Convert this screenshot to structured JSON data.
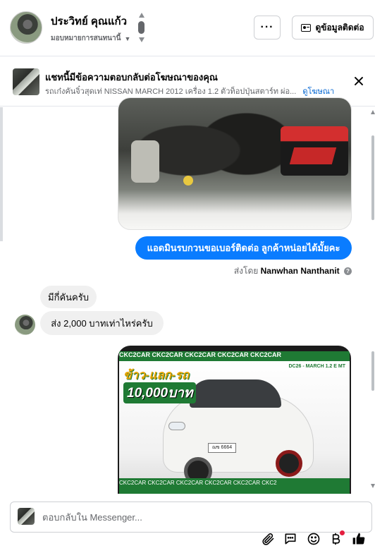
{
  "header": {
    "contact_name": "ประวิทย์ คุณแก้ว",
    "assign_label": "มอบหมายการสนทนานี้",
    "more_label": "···",
    "view_contact_label": "ดูข้อมูลติดต่อ"
  },
  "ad_banner": {
    "title": "แชทนี้มีข้อความตอบกลับต่อโฆษณาของคุณ",
    "description": "รถเก๋งคันจิ๋วสุดเท่ NISSAN MARCH 2012 เครื่อง 1.2 ตัวท็อปปุ่นสตาร์ท ผ่อ...",
    "link_label": "ดูโฆษณา"
  },
  "messages": {
    "outgoing_text": "แอดมินรบกวนขอเบอร์ติดต่อ ลูกค้าหน่อยได้มั้ยคะ",
    "sent_by_prefix": "ส่งโดย",
    "sent_by_name": "Nanwhan Nanthanit",
    "incoming_1": "มีกี่คันครับ",
    "incoming_2": "ส่ง 2,000 บาทเท่าไหร่ครับ"
  },
  "ad_image": {
    "top_band": "CKC2CAR CKC2CAR CKC2CAR CKC2CAR CKC2CAR",
    "promo_line1": "ข้าว-แลก-รถ",
    "promo_line2": "10,000บาท",
    "tag": "DC26 - MARCH 1.2 E MT",
    "plate": "ฌข 6664",
    "bottom_band": "CKC2CAR CKC2CAR CKC2CAR CKC2CAR CKC2CAR CKC2"
  },
  "composer": {
    "placeholder": "ตอบกลับใน Messenger..."
  },
  "toolbar": {
    "icons": [
      "paperclip-icon",
      "saved-reply-icon",
      "emoji-icon",
      "baht-icon",
      "like-icon"
    ]
  },
  "colors": {
    "accent": "#0a7cff",
    "link": "#0064d1",
    "incoming_bubble": "#f0f0f0",
    "ad_green": "#1f7a34",
    "notification": "#e41e3f"
  }
}
